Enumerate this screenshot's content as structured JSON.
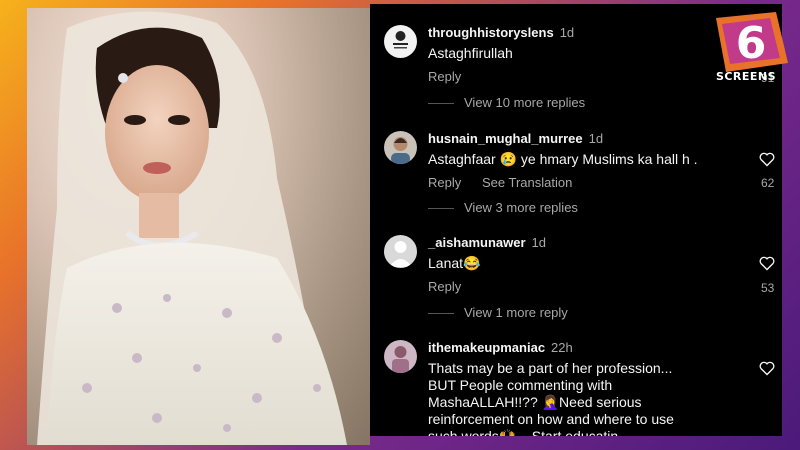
{
  "brand": {
    "logo_number": "6",
    "logo_text": "SCREENS"
  },
  "comments": [
    {
      "username": "throughhistoryslens",
      "time": "1d",
      "text": "Astaghfirullah",
      "reply": "Reply",
      "likes": "91",
      "view_replies": "View 10 more replies",
      "avatar_text": "THROUGH HISTORY'S LENS"
    },
    {
      "username": "husnain_mughal_murree",
      "time": "1d",
      "text": "Astaghfaar 😢 ye hmary Muslims ka hall h .",
      "reply": "Reply",
      "translate": "See Translation",
      "likes": "62",
      "view_replies": "View 3 more replies"
    },
    {
      "username": "_aishamunawer",
      "time": "1d",
      "text": "Lanat😂",
      "reply": "Reply",
      "likes": "53",
      "view_replies": "View 1 more reply"
    },
    {
      "username": "ithemakeupmaniac",
      "time": "22h",
      "text_lines": [
        "Thats may be a part of her profession...",
        "BUT People commenting with",
        "MashaALLAH!!?? 🤦‍♀️Need serious",
        "reinforcement on how and where to use",
        "such words🙌... Start educatin"
      ]
    }
  ]
}
